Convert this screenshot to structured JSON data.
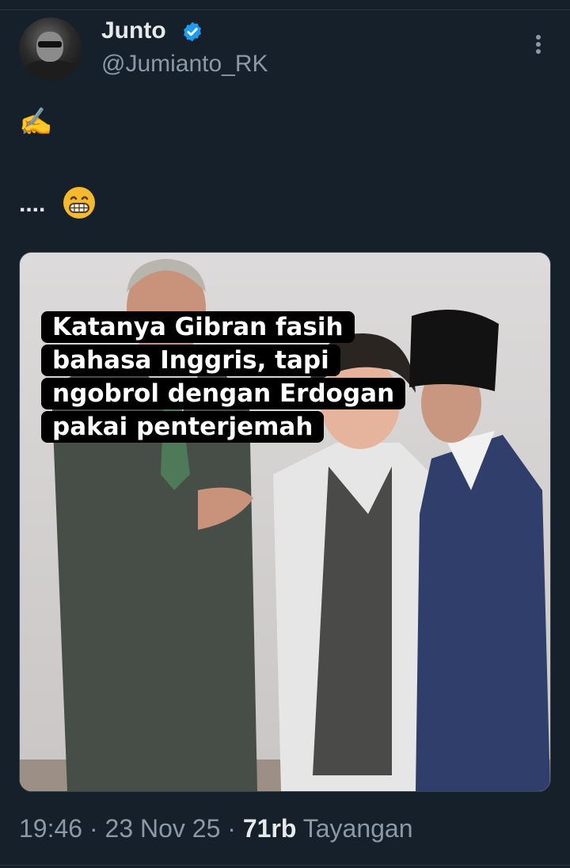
{
  "tweet": {
    "author_name": "Junto",
    "author_handle": "@Jumianto_RK",
    "line1_emoji": "✍️",
    "line2_text": "....",
    "line2_emoji": "😁",
    "media": {
      "caption_lines": [
        "Katanya Gibran fasih",
        "bahasa Inggris, tapi",
        "ngobrol dengan Erdogan",
        "pakai penterjemah"
      ]
    },
    "time": "19:46",
    "date": "23 Nov 25",
    "views_count": "71rb",
    "views_label": "Tayangan",
    "separator": "·"
  },
  "colors": {
    "background": "#15202b",
    "verified_blue": "#1d9bf0",
    "secondary_text": "#8b98a5"
  },
  "icons": [
    "verified-badge-icon",
    "more-options-icon",
    "grinning-face-emoji",
    "writing-hand-emoji"
  ]
}
